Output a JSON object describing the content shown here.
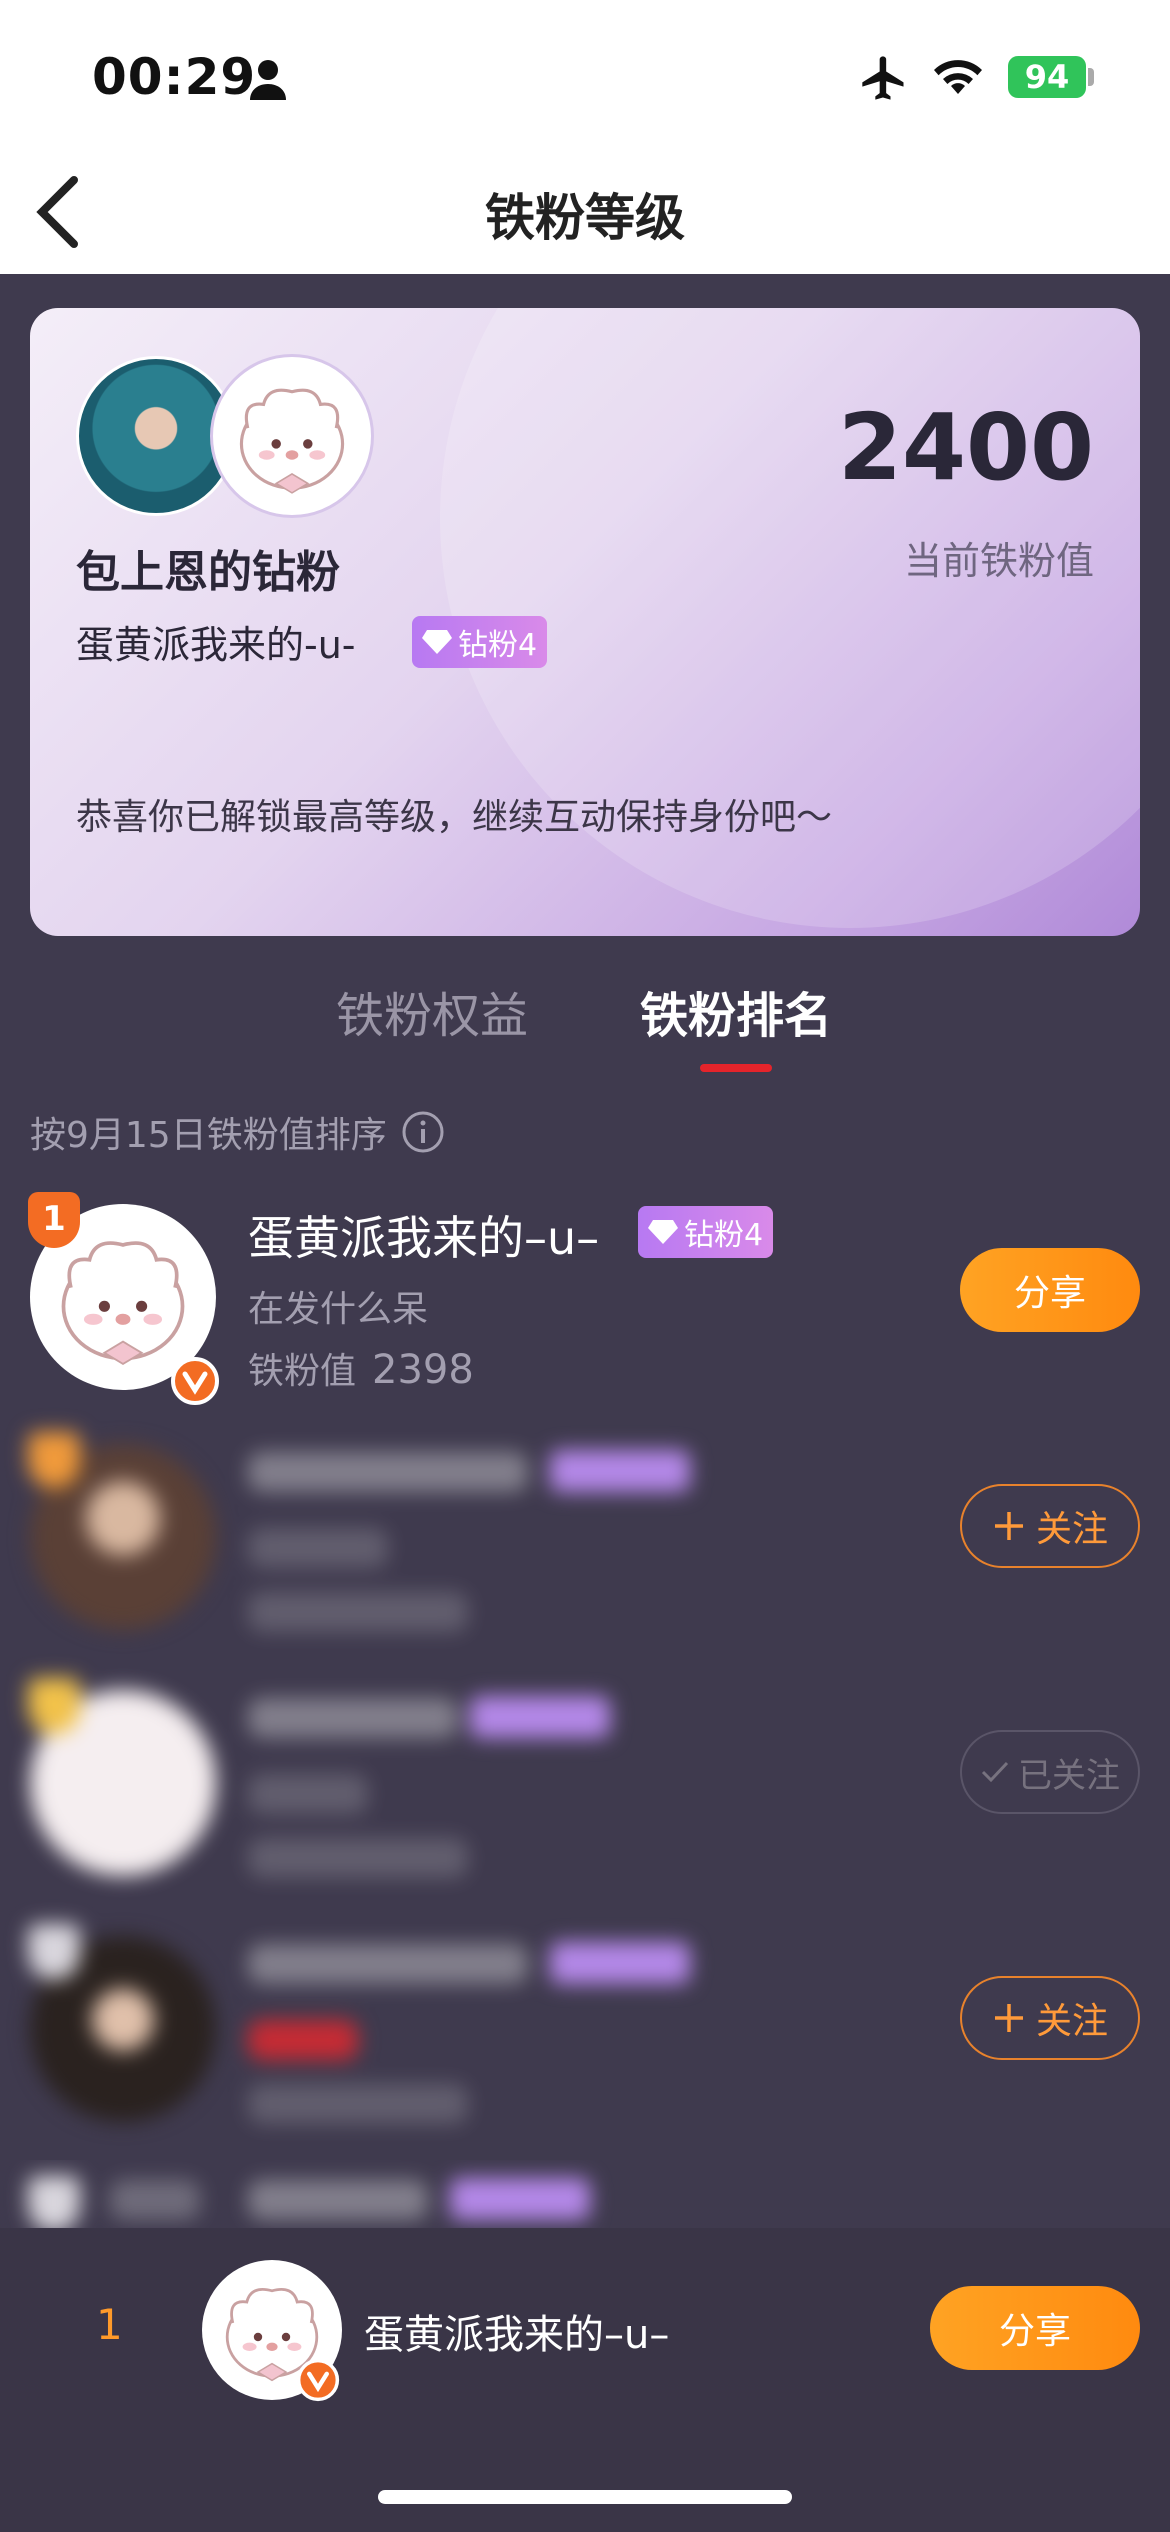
{
  "status": {
    "time": "00:29",
    "battery": "94"
  },
  "nav": {
    "title": "铁粉等级"
  },
  "card": {
    "title": "包上恩的钻粉",
    "username": "蛋黄派我来的-u-",
    "badge": "钻粉4",
    "score": "2400",
    "score_label": "当前铁粉值",
    "congrats": "恭喜你已解锁最高等级，继续互动保持身份吧～"
  },
  "tabs": [
    {
      "label": "铁粉权益",
      "active": false
    },
    {
      "label": "铁粉排名",
      "active": true
    }
  ],
  "sort_note": "按9月15日铁粉值排序",
  "ranking": [
    {
      "rank": "1",
      "name": "蛋黄派我来的–u–",
      "badge": "钻粉4",
      "subtitle": "在发什么呆",
      "value_label": "铁粉值",
      "value": "2398",
      "action": "分享"
    },
    {
      "action": "关注"
    },
    {
      "action": "已关注"
    },
    {
      "action": "关注"
    }
  ],
  "bottom": {
    "rank": "1",
    "name": "蛋黄派我来的–u–",
    "action": "分享"
  },
  "colors": {
    "accent": "#ff8a0f",
    "tab_underline": "#e5242b",
    "badge": "#b779f2",
    "background": "#3f3a4e"
  }
}
